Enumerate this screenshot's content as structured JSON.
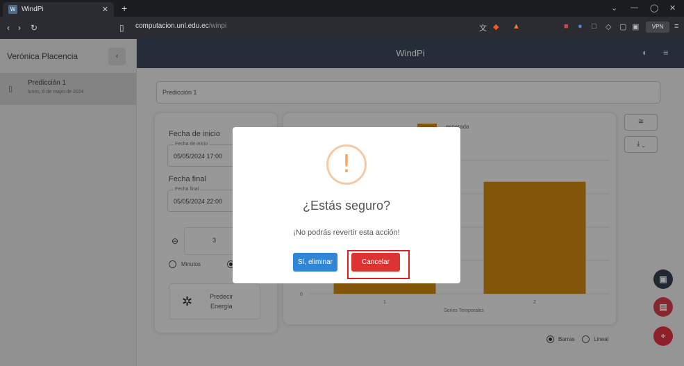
{
  "browser": {
    "tab_title": "WindPi",
    "tab_favicon": "W",
    "url_domain": "computacion.unl.edu.ec",
    "url_path": "/winpi",
    "vpn_label": "VPN"
  },
  "sidebar": {
    "user_name": "Verónica Placencia",
    "items": [
      {
        "title": "Predicción 1",
        "date": "lunes, 6 de mayo de 2024"
      }
    ]
  },
  "header": {
    "title": "WindPi"
  },
  "form": {
    "name_value": "Predicción 1",
    "start_label": "Fecha de inicio",
    "start_legend": "Fecha de inicio",
    "start_value": "05/05/2024 17:00",
    "end_label": "Fecha final",
    "end_legend": "Fecha final",
    "end_value": "05/05/2024 22:00",
    "stepper_value": "3",
    "radio_minutes": "Minutos",
    "predict_line1": "Predecir",
    "predict_line2": "Energía"
  },
  "chart_data": {
    "type": "bar",
    "categories": [
      "1",
      "2"
    ],
    "series": [
      {
        "name": "…esperada",
        "values": [
          null,
          0.84
        ]
      }
    ],
    "xlabel": "Series Temporales",
    "ylabel": "",
    "ytick_bottom": "0",
    "bar_color": "#d18b12"
  },
  "view_options": {
    "bars": "Barras",
    "linear": "Lineal",
    "selected": "Barras"
  },
  "dialog": {
    "icon": "!",
    "title": "¿Estás seguro?",
    "text": "¡No podrás revertir esta acción!",
    "confirm_label": "Sí, eliminar",
    "cancel_label": "Cancelar"
  },
  "colors": {
    "topbar": "#3e4a5e",
    "confirm": "#3085d6",
    "cancel": "#dd3333",
    "fab_save": "#37414f",
    "fab_delete": "#d9404e",
    "fab_add": "#e8343f"
  }
}
